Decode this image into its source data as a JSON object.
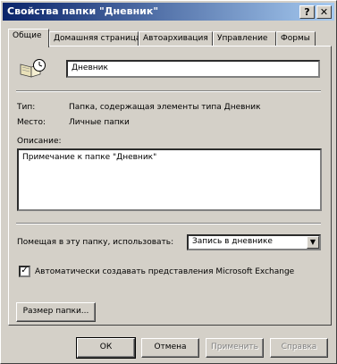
{
  "window": {
    "title": "Свойства папки \"Дневник\"",
    "help_glyph": "?",
    "close_glyph": "✕"
  },
  "tabs": [
    {
      "label": "Общие"
    },
    {
      "label": "Домашняя страница"
    },
    {
      "label": "Автоархивация"
    },
    {
      "label": "Управление"
    },
    {
      "label": "Формы"
    }
  ],
  "general": {
    "folder_name": "Дневник",
    "type_label": "Тип:",
    "type_value": "Папка, содержащая элементы типа Дневник",
    "location_label": "Место:",
    "location_value": "Личные папки",
    "description_label": "Описание:",
    "description_value": "Примечание к папке \"Дневник\"",
    "post_label": "Помещая в эту папку, использовать:",
    "post_value": "Запись в дневнике",
    "checkbox_label": "Автоматически создавать представления Microsoft Exchange",
    "checkbox_checked": true,
    "checkbox_glyph": "✓",
    "folder_size_button": "Размер папки...",
    "dropdown_glyph": "▼"
  },
  "buttons": {
    "ok": "ОК",
    "cancel": "Отмена",
    "apply": "Применить",
    "help": "Справка"
  }
}
